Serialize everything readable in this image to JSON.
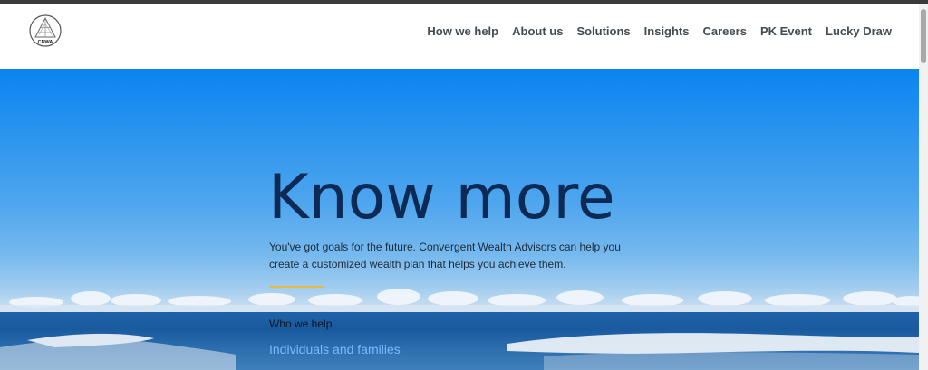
{
  "header": {
    "logo_text": "CNWA",
    "nav": [
      "How we help",
      "About us",
      "Solutions",
      "Insights",
      "Careers",
      "PK Event",
      "Lucky Draw"
    ]
  },
  "hero": {
    "title": "Know more",
    "description": "You've got goals for the future. Convergent Wealth Advisors can help you create a customized wealth plan that helps you achieve them.",
    "section_label": "Who we help",
    "link_label": "Individuals and families"
  },
  "colors": {
    "title": "#0d2a55",
    "accent_rule": "#e5b93a",
    "link": "#7cb7ff",
    "nav_text": "#444b52"
  }
}
